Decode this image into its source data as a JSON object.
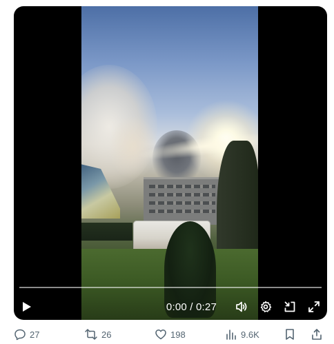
{
  "video": {
    "time_display": "0:00 / 0:27",
    "progress_fraction": 0.0,
    "controls": {
      "play_icon": "play-icon",
      "volume_icon": "volume-icon",
      "settings_icon": "gear-icon",
      "exit_icon": "exit-fullscreen-icon",
      "fullscreen_icon": "fullscreen-icon"
    }
  },
  "actions": {
    "reply_count": "27",
    "repost_count": "26",
    "like_count": "198",
    "view_count": "9.6K"
  },
  "colors": {
    "progress_accent": "#1d9bf0",
    "action_text": "#536471"
  }
}
